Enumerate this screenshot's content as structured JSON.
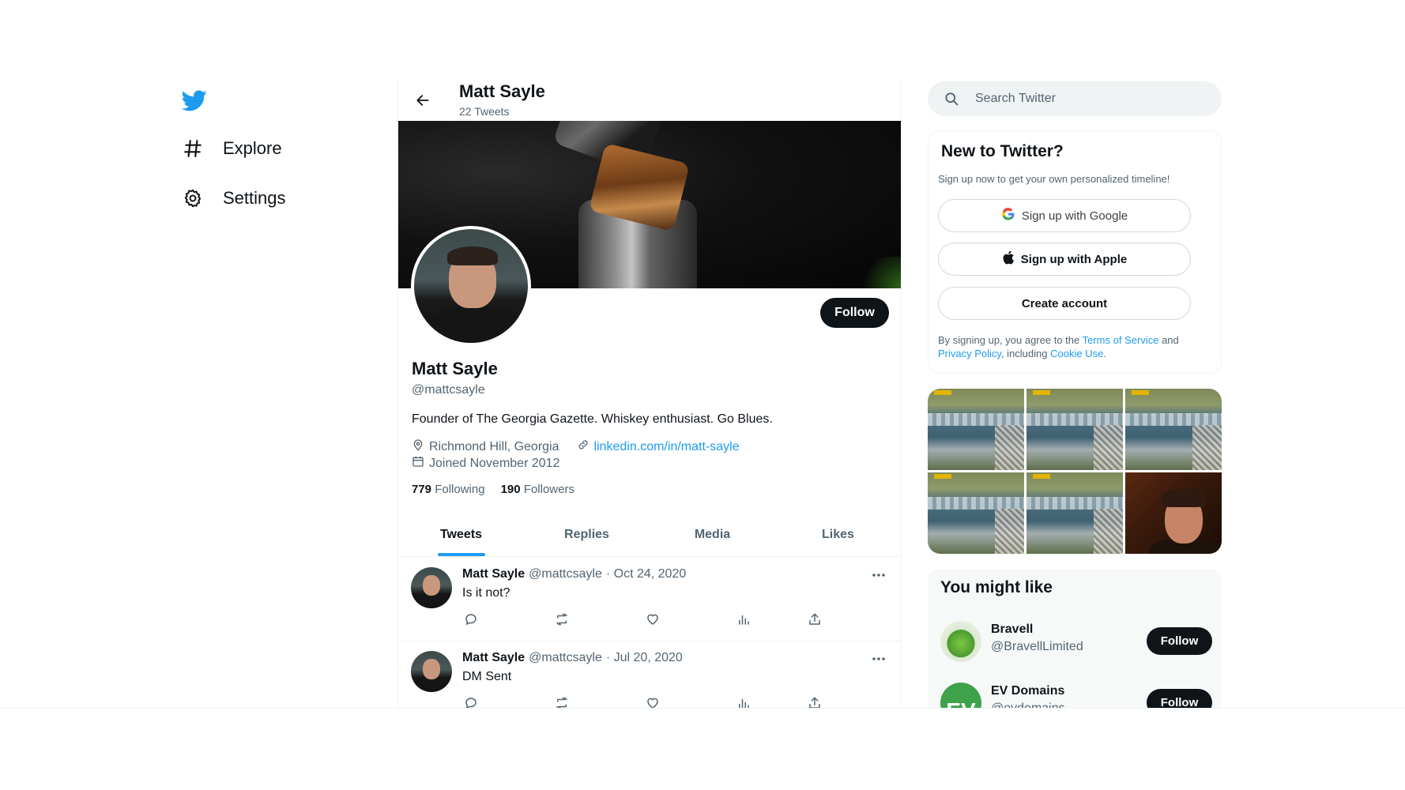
{
  "nav": {
    "logo_icon": "twitter-bird-icon",
    "items": [
      {
        "label": "Explore",
        "icon": "hashtag-icon"
      },
      {
        "label": "Settings",
        "icon": "gear-icon"
      }
    ]
  },
  "profile": {
    "top_name": "Matt Sayle",
    "tweet_count": "22 Tweets",
    "name": "Matt Sayle",
    "handle": "@mattcsayle",
    "follow_label": "Follow",
    "bio": "Founder of The Georgia Gazette. Whiskey enthusiast. Go Blues.",
    "location": "Richmond Hill, Georgia",
    "website": "linkedin.com/in/matt-sayle",
    "joined": "Joined November 2012",
    "following_count": "779",
    "following_label": "Following",
    "followers_count": "190",
    "followers_label": "Followers"
  },
  "tabs": [
    {
      "label": "Tweets",
      "active": true
    },
    {
      "label": "Replies",
      "active": false
    },
    {
      "label": "Media",
      "active": false
    },
    {
      "label": "Likes",
      "active": false
    }
  ],
  "tweets": [
    {
      "name": "Matt Sayle",
      "handle": "@mattcsayle",
      "date": "· Oct 24, 2020",
      "text": "Is it not?"
    },
    {
      "name": "Matt Sayle",
      "handle": "@mattcsayle",
      "date": "· Jul 20, 2020",
      "text": "DM Sent"
    }
  ],
  "search": {
    "placeholder": "Search Twitter"
  },
  "signup": {
    "title": "New to Twitter?",
    "subtitle": "Sign up now to get your own personalized timeline!",
    "google_label": "Sign up with Google",
    "apple_label": "Sign up with Apple",
    "create_label": "Create account",
    "legal_prefix": "By signing up, you agree to the",
    "terms": "Terms of Service",
    "and": "and",
    "privacy": "Privacy Policy",
    "including": ", including",
    "cookie": "Cookie Use",
    "period": "."
  },
  "who_to_follow": {
    "title": "You might like",
    "items": [
      {
        "name": "Bravell",
        "handle": "@BravellLimited",
        "follow_label": "Follow"
      },
      {
        "name": "EV Domains",
        "handle": "@evdomains",
        "follow_label": "Follow"
      }
    ]
  },
  "colors": {
    "accent": "#1d9bf0",
    "text": "#0f1419",
    "secondary": "#536471"
  }
}
